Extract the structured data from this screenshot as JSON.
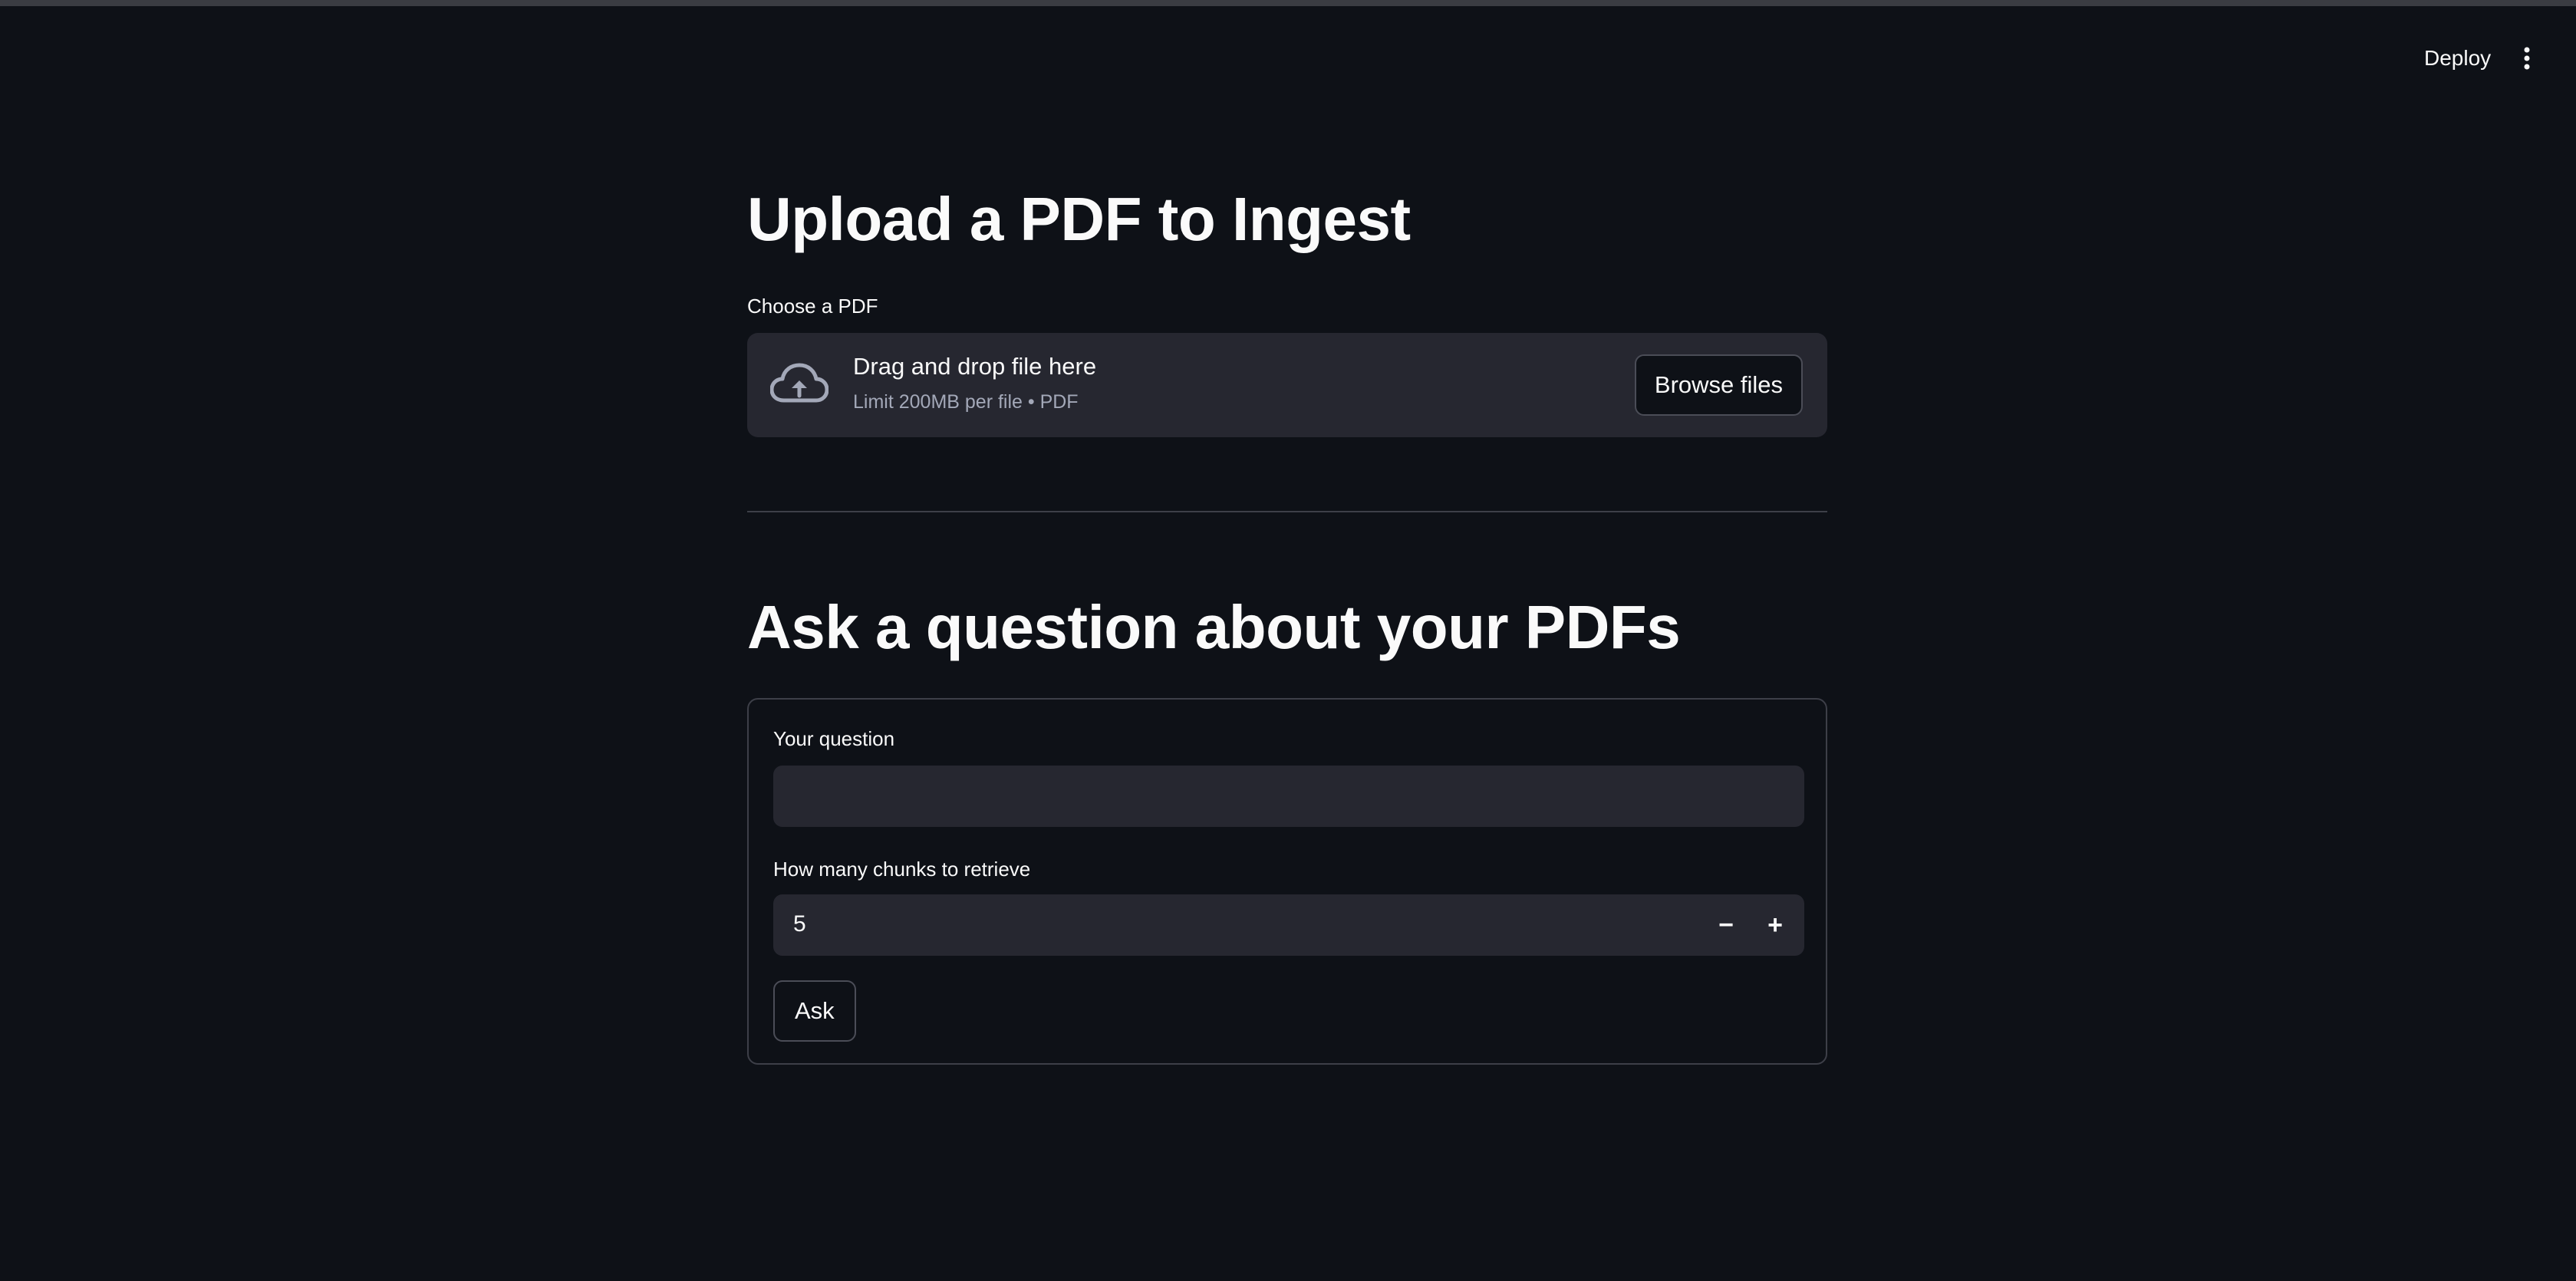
{
  "header": {
    "deploy_label": "Deploy"
  },
  "upload": {
    "title": "Upload a PDF to Ingest",
    "label": "Choose a PDF",
    "dropzone_title": "Drag and drop file here",
    "dropzone_sub": "Limit 200MB per file • PDF",
    "browse_label": "Browse files"
  },
  "ask": {
    "title": "Ask a question about your PDFs",
    "question_label": "Your question",
    "question_value": "",
    "chunks_label": "How many chunks to retrieve",
    "chunks_value": "5",
    "minus_symbol": "−",
    "plus_symbol": "+",
    "ask_label": "Ask"
  },
  "colors": {
    "background": "#0e1117",
    "surface": "#262730",
    "text": "#fafafa",
    "muted": "#a3a8b8"
  },
  "icons": [
    "cloud-upload-icon",
    "more-vertical-icon"
  ]
}
